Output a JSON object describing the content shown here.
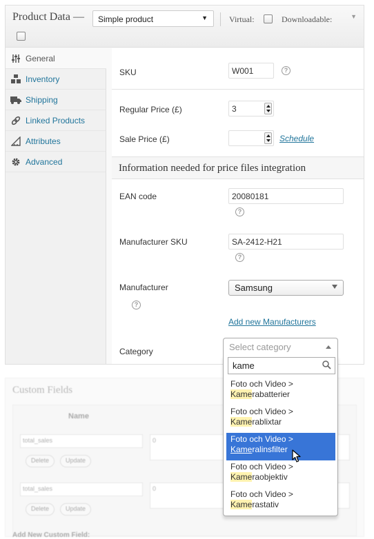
{
  "product_data": {
    "title": "Product Data —",
    "type_select": "Simple product",
    "virtual_label": "Virtual:",
    "downloadable_label": "Downloadable:"
  },
  "tabs": [
    {
      "label": "General",
      "icon": "sliders-icon"
    },
    {
      "label": "Inventory",
      "icon": "boxes-icon"
    },
    {
      "label": "Shipping",
      "icon": "truck-icon"
    },
    {
      "label": "Linked Products",
      "icon": "link-icon"
    },
    {
      "label": "Attributes",
      "icon": "ruler-icon"
    },
    {
      "label": "Advanced",
      "icon": "gear-icon"
    }
  ],
  "general": {
    "sku_label": "SKU",
    "sku_value": "W001",
    "regular_price_label": "Regular Price (£)",
    "regular_price_value": "3",
    "sale_price_label": "Sale Price (£)",
    "sale_price_value": "",
    "schedule_link": "Schedule"
  },
  "price_files": {
    "heading": "Information needed for price files integration",
    "ean_label": "EAN code",
    "ean_value": "20080181",
    "manufacturer_sku_label": "Manufacturer SKU",
    "manufacturer_sku_value": "SA-2412-H21",
    "manufacturer_label": "Manufacturer",
    "manufacturer_value": "Samsung",
    "add_manufacturer_link": "Add new Manufacturers",
    "category_label": "Category",
    "category_placeholder": "Select category",
    "category_search": "kame"
  },
  "category_options": [
    {
      "line1": "Foto och Video >",
      "match": "Kame",
      "rest": "rabatterier",
      "selected": false
    },
    {
      "line1": "Foto och Video >",
      "match": "Kame",
      "rest": "rablixtar",
      "selected": false
    },
    {
      "line1": "Foto och Video >",
      "match": "Kame",
      "rest": "ralinsfilter",
      "selected": true
    },
    {
      "line1": "Foto och Video >",
      "match": "Kame",
      "rest": "raobjektiv",
      "selected": false
    },
    {
      "line1": "Foto och Video >",
      "match": "Kame",
      "rest": "rastativ",
      "selected": false
    }
  ],
  "custom_fields": {
    "title": "Custom Fields",
    "name_header": "Name",
    "rows": [
      {
        "key": "total_sales",
        "value": "0"
      },
      {
        "key": "total_sales",
        "value": "0"
      }
    ],
    "delete_label": "Delete",
    "update_label": "Update",
    "add_new_label": "Add New Custom Field:"
  },
  "colors": {
    "link": "#21759b",
    "selected_option": "#3875d7",
    "match_highlight": "#fff3b0"
  }
}
